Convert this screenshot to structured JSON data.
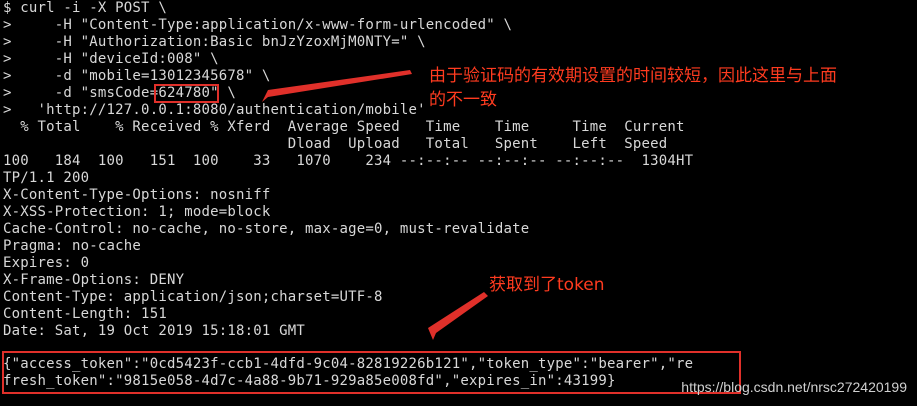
{
  "terminal": {
    "lines": [
      "$ curl -i -X POST \\",
      ">     -H \"Content-Type:application/x-www-form-urlencoded\" \\",
      ">     -H \"Authorization:Basic bnJzYzoxMjM0NTY=\" \\",
      ">     -H \"deviceId:008\" \\",
      ">     -d \"mobile=13012345678\" \\",
      ">     -d \"smsCode=624780\" \\",
      ">   'http://127.0.0.1:8080/authentication/mobile'",
      "  % Total    % Received % Xferd  Average Speed   Time    Time     Time  Current",
      "                                 Dload  Upload   Total   Spent    Left  Speed",
      "100   184  100   151  100    33   1070    234 --:--:-- --:--:-- --:--:--  1304HT",
      "TP/1.1 200",
      "X-Content-Type-Options: nosniff",
      "X-XSS-Protection: 1; mode=block",
      "Cache-Control: no-cache, no-store, max-age=0, must-revalidate",
      "Pragma: no-cache",
      "Expires: 0",
      "X-Frame-Options: DENY",
      "Content-Type: application/json;charset=UTF-8",
      "Content-Length: 151",
      "Date: Sat, 19 Oct 2019 15:18:01 GMT",
      "",
      "{\"access_token\":\"0cd5423f-ccb1-4dfd-9c04-82819226b121\",\"token_type\":\"bearer\",\"re",
      "fresh_token\":\"9815e058-4d7c-4a88-9b71-929a85e008fd\",\"expires_in\":43199}"
    ]
  },
  "annotations": {
    "sms_note_line1": "由于验证码的有效期设置的时间较短，因此这里与上面",
    "sms_note_line2": "的不一致",
    "token_note": "获取到了token"
  },
  "watermark": "https://blog.csdn.net/nrsc272420199",
  "colors": {
    "background": "#000000",
    "text": "#d8d8d8",
    "annotation": "#e0302a"
  }
}
